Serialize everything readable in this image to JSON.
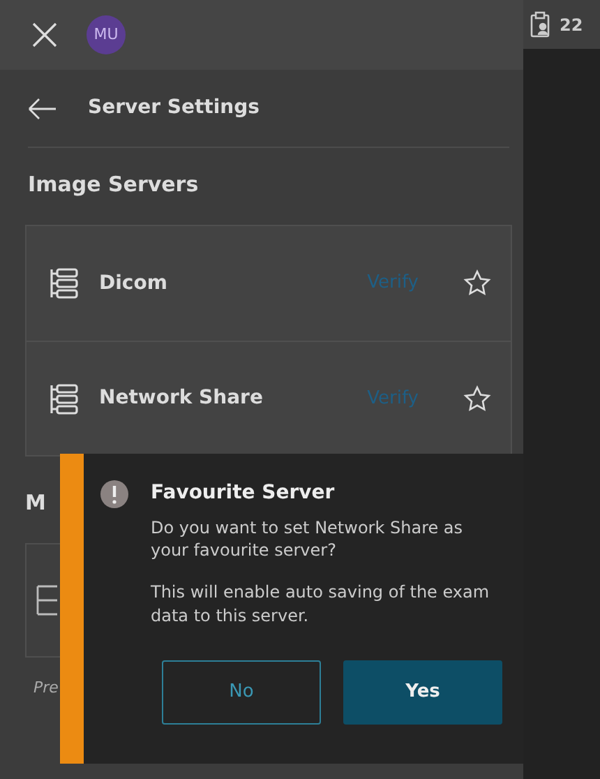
{
  "top_bar": {
    "avatar": "MU"
  },
  "side_badge": {
    "count": "22"
  },
  "header": {
    "title": "Server Settings"
  },
  "section": {
    "title": "Image Servers"
  },
  "servers": [
    {
      "name": "Dicom",
      "action": "Verify",
      "favourite": false
    },
    {
      "name": "Network Share",
      "action": "Verify",
      "favourite": false
    }
  ],
  "hidden_section": {
    "title_visible": "M",
    "note_visible": "Pre"
  },
  "dialog": {
    "title": "Favourite Server",
    "message": "Do you want to set Network Share as your favourite server?",
    "detail": "This will enable auto saving of the exam data to this server.",
    "buttons": [
      {
        "label": "No",
        "kind": "secondary"
      },
      {
        "label": "Yes",
        "kind": "primary"
      }
    ]
  }
}
